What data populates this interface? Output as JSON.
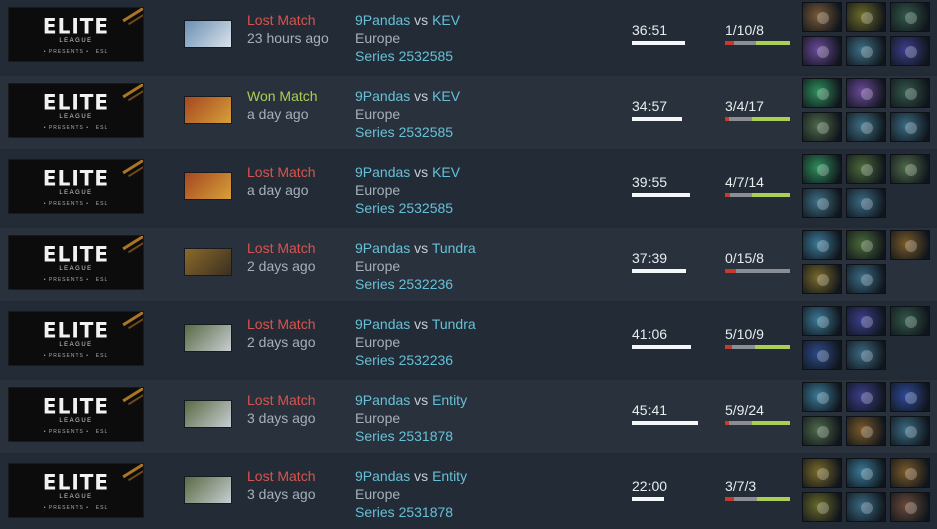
{
  "logo": {
    "wordmark": "ELITE",
    "sub": "LEAGUE",
    "meta": "• PRESENTS •    ESL"
  },
  "matches": [
    {
      "hero_icon": "kunkka-portrait-icon",
      "hero_colors": [
        "#6b8fb4",
        "#d9e3ea"
      ],
      "result": "Lost Match",
      "result_type": "lost",
      "when": "23 hours ago",
      "team_a": "9Pandas",
      "vs": "vs",
      "team_b": "KEV",
      "region": "Europe",
      "series": "Series 2532585",
      "duration": "36:51",
      "duration_fraction": 0.66,
      "kda": "1/10/8",
      "kda_values": [
        1,
        10,
        8
      ],
      "items": [
        {
          "icon": "boots-icon",
          "color": "#7a5a38"
        },
        {
          "icon": "blink-dagger-icon",
          "color": "#6d6b2a"
        },
        {
          "icon": "quarterstaff-icon",
          "color": "#33584a"
        },
        {
          "icon": "bottle-icon",
          "color": "#6c4a9a"
        },
        {
          "icon": "eul-scepter-icon",
          "color": "#3e6f86"
        },
        {
          "icon": "shadow-blade-icon",
          "color": "#3b3f8c"
        }
      ]
    },
    {
      "hero_icon": "earthshaker-portrait-icon",
      "hero_colors": [
        "#a5471f",
        "#d8a03a"
      ],
      "result": "Won Match",
      "result_type": "won",
      "when": "a day ago",
      "team_a": "9Pandas",
      "vs": "vs",
      "team_b": "KEV",
      "region": "Europe",
      "series": "Series 2532585",
      "duration": "34:57",
      "duration_fraction": 0.62,
      "kda": "3/4/17",
      "kda_values": [
        3,
        4,
        17
      ],
      "items": [
        {
          "icon": "tranquil-boots-icon",
          "color": "#2f8f5c"
        },
        {
          "icon": "bottle-icon",
          "color": "#6c4a9a"
        },
        {
          "icon": "quarterstaff-icon",
          "color": "#33584a"
        },
        {
          "icon": "meteor-hammer-icon",
          "color": "#4f6a4a"
        },
        {
          "icon": "eul-scepter-icon",
          "color": "#3e6f86"
        },
        {
          "icon": "force-staff-icon",
          "color": "#3b6a84"
        }
      ]
    },
    {
      "hero_icon": "earthshaker-portrait-icon",
      "hero_colors": [
        "#a5471f",
        "#d8a03a"
      ],
      "result": "Lost Match",
      "result_type": "lost",
      "when": "a day ago",
      "team_a": "9Pandas",
      "vs": "vs",
      "team_b": "KEV",
      "region": "Europe",
      "series": "Series 2532585",
      "duration": "39:55",
      "duration_fraction": 0.72,
      "kda": "4/7/14",
      "kda_values": [
        4,
        7,
        14
      ],
      "items": [
        {
          "icon": "tranquil-boots-icon",
          "color": "#2f8f5c"
        },
        {
          "icon": "quarterstaff-icon",
          "color": "#4b6a3a"
        },
        {
          "icon": "meteor-hammer-icon",
          "color": "#4f6a4a"
        },
        {
          "icon": "eul-scepter-icon",
          "color": "#3e6f86"
        },
        {
          "icon": "force-staff-icon",
          "color": "#3b6a84"
        }
      ]
    },
    {
      "hero_icon": "tusk-portrait-icon",
      "hero_colors": [
        "#8a6a2a",
        "#3a2f20"
      ],
      "result": "Lost Match",
      "result_type": "lost",
      "when": "2 days ago",
      "team_a": "9Pandas",
      "vs": "vs",
      "team_b": "Tundra",
      "region": "Europe",
      "series": "Series 2532236",
      "duration": "37:39",
      "duration_fraction": 0.68,
      "kda": "0/15/8",
      "kda_values": [
        0,
        15,
        8
      ],
      "items": [
        {
          "icon": "magic-wand-icon",
          "color": "#3b7a98"
        },
        {
          "icon": "quarterstaff-icon",
          "color": "#4b6a3a"
        },
        {
          "icon": "bottle-icon",
          "color": "#7a5a2a"
        },
        {
          "icon": "urn-icon",
          "color": "#7a6a2a"
        },
        {
          "icon": "force-staff-icon",
          "color": "#3b6a84"
        }
      ]
    },
    {
      "hero_icon": "tiny-portrait-icon",
      "hero_colors": [
        "#5a6a44",
        "#c8ced2"
      ],
      "result": "Lost Match",
      "result_type": "lost",
      "when": "2 days ago",
      "team_a": "9Pandas",
      "vs": "vs",
      "team_b": "Tundra",
      "region": "Europe",
      "series": "Series 2532236",
      "duration": "41:06",
      "duration_fraction": 0.74,
      "kda": "5/10/9",
      "kda_values": [
        5,
        10,
        9
      ],
      "items": [
        {
          "icon": "magic-wand-icon",
          "color": "#3b7a98"
        },
        {
          "icon": "shadow-blade-icon",
          "color": "#3b3f8c"
        },
        {
          "icon": "quarterstaff-icon",
          "color": "#33584a"
        },
        {
          "icon": "blink-dagger-icon",
          "color": "#2d4a8a"
        },
        {
          "icon": "force-staff-icon",
          "color": "#3b6a84"
        }
      ]
    },
    {
      "hero_icon": "tiny-portrait-icon",
      "hero_colors": [
        "#5a6a44",
        "#c8ced2"
      ],
      "result": "Lost Match",
      "result_type": "lost",
      "when": "3 days ago",
      "team_a": "9Pandas",
      "vs": "vs",
      "team_b": "Entity",
      "region": "Europe",
      "series": "Series 2531878",
      "duration": "45:41",
      "duration_fraction": 0.82,
      "kda": "5/9/24",
      "kda_values": [
        5,
        9,
        24
      ],
      "items": [
        {
          "icon": "magic-wand-icon",
          "color": "#3b7a98"
        },
        {
          "icon": "shadow-blade-icon",
          "color": "#3b3f8c"
        },
        {
          "icon": "aether-lens-icon",
          "color": "#2e4a9a"
        },
        {
          "icon": "meteor-hammer-icon",
          "color": "#4f6a4a"
        },
        {
          "icon": "bottle-icon",
          "color": "#7a5a2a"
        },
        {
          "icon": "force-staff-icon",
          "color": "#3b6a84"
        }
      ]
    },
    {
      "hero_icon": "tiny-portrait-icon",
      "hero_colors": [
        "#5a6a44",
        "#c8ced2"
      ],
      "result": "Lost Match",
      "result_type": "lost",
      "when": "3 days ago",
      "team_a": "9Pandas",
      "vs": "vs",
      "team_b": "Entity",
      "region": "Europe",
      "series": "Series 2531878",
      "duration": "22:00",
      "duration_fraction": 0.4,
      "kda": "3/7/3",
      "kda_values": [
        3,
        7,
        3
      ],
      "items": [
        {
          "icon": "gauntlets-icon",
          "color": "#7a6a2a"
        },
        {
          "icon": "magic-wand-icon",
          "color": "#3b7a98"
        },
        {
          "icon": "bottle-icon",
          "color": "#7a5a2a"
        },
        {
          "icon": "gauntlets-icon",
          "color": "#6a6a2a"
        },
        {
          "icon": "force-staff-icon",
          "color": "#3b6a84"
        },
        {
          "icon": "boots-icon",
          "color": "#6a4a3a"
        }
      ]
    }
  ]
}
